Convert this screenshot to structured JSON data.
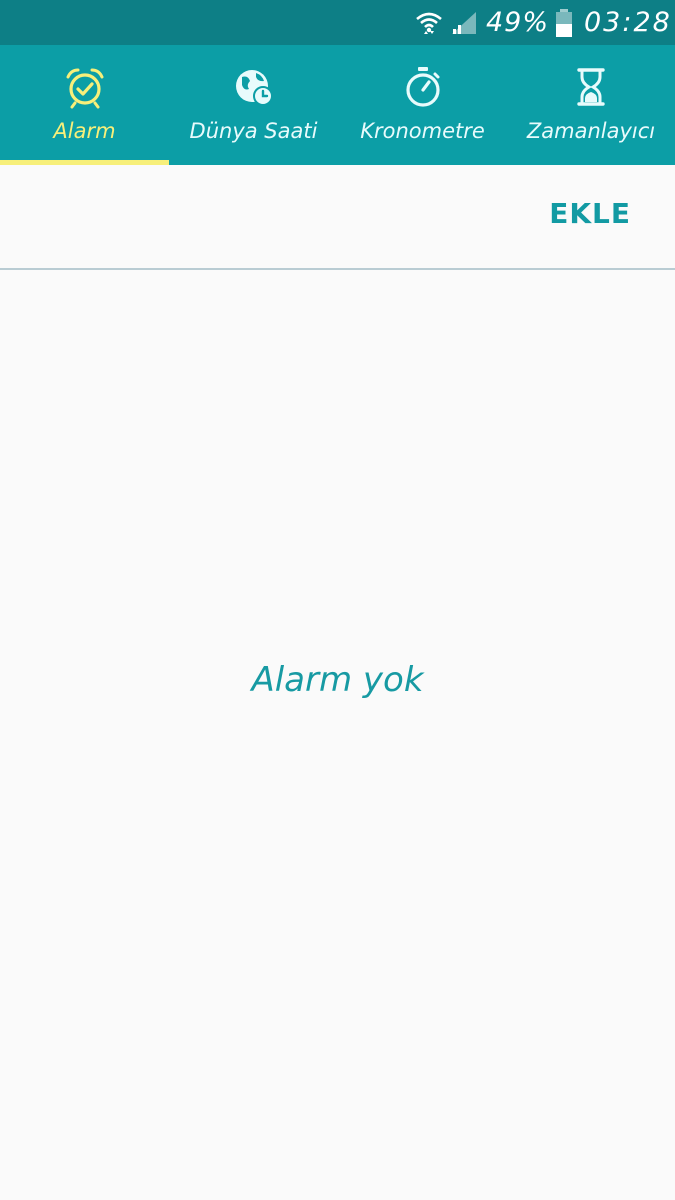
{
  "status_bar": {
    "battery_percent": "49%",
    "time": "03:28",
    "icons": [
      "wifi-icon",
      "signal-icon",
      "battery-icon"
    ]
  },
  "tabs": [
    {
      "label": "Alarm",
      "icon": "alarm-clock-icon",
      "active": true
    },
    {
      "label": "Dünya Saati",
      "icon": "globe-clock-icon",
      "active": false
    },
    {
      "label": "Kronometre",
      "icon": "stopwatch-icon",
      "active": false
    },
    {
      "label": "Zamanlayıcı",
      "icon": "hourglass-icon",
      "active": false
    }
  ],
  "toolbar": {
    "add_label": "EKLE"
  },
  "main": {
    "empty_message": "Alarm yok"
  },
  "colors": {
    "status_bar": "#0d7f86",
    "tab_bar": "#0c9ea6",
    "active_tab": "#f7ef7a",
    "accent_text": "#129aa3",
    "background": "#fafafa"
  }
}
